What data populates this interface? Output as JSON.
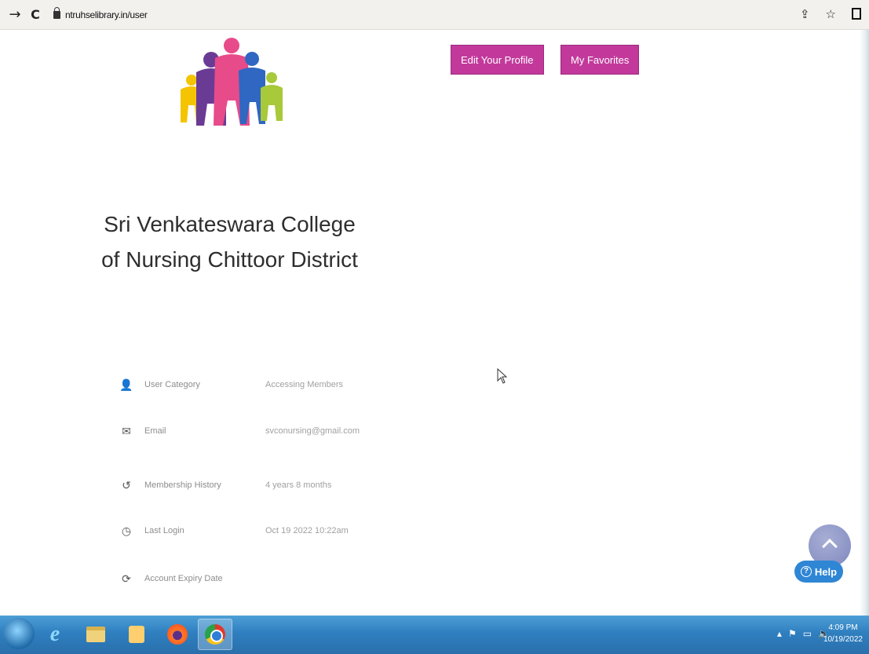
{
  "browser": {
    "url": "ntruhselibrary.in/user",
    "back_icon": "arrow-right-icon",
    "reload_icon": "reload-icon"
  },
  "header": {
    "edit_profile_label": "Edit Your Profile",
    "favorites_label": "My Favorites"
  },
  "profile": {
    "college_name": "Sri Venkateswara College of Nursing Chittoor District",
    "rows": [
      {
        "icon": "user-icon",
        "label": "User Category",
        "value": "Accessing Members"
      },
      {
        "icon": "mail-icon",
        "label": "Email",
        "value": "svconursing@gmail.com"
      },
      {
        "icon": "history-icon",
        "label": "Membership History",
        "value": "4 years 8 months"
      },
      {
        "icon": "clock-icon",
        "label": "Last Login",
        "value": "Oct 19 2022 10:22am"
      },
      {
        "icon": "refresh-icon",
        "label": "Account Expiry Date",
        "value": ""
      }
    ]
  },
  "help": {
    "label": "Help"
  },
  "taskbar": {
    "time": "4:09 PM",
    "date": "10/19/2022"
  },
  "colors": {
    "button_bg": "#c2399b",
    "help_bg": "#2f86d4",
    "taskbar": "#2f7fc0"
  }
}
